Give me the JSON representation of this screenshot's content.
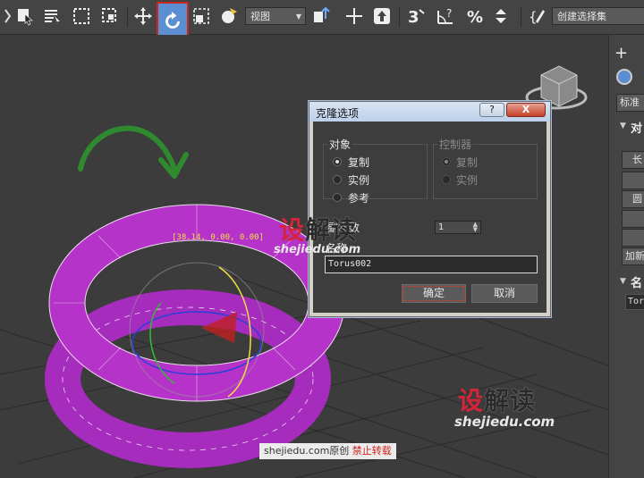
{
  "toolbar": {
    "view_dropdown": "视图",
    "selection_set_placeholder": "创建选择集"
  },
  "right_panel": {
    "tab_label": "标准",
    "section1_label": "对",
    "btn_labels": [
      "长",
      "圆",
      "加新"
    ],
    "section2_label": "名",
    "name_value": "Tor"
  },
  "dialog": {
    "title": "克隆选项",
    "help_label": "?",
    "close_label": "X",
    "object_group": {
      "label": "对象",
      "options": [
        "复制",
        "实例",
        "参考"
      ],
      "selected": "复制"
    },
    "controller_group": {
      "label": "控制器",
      "options": [
        "复制",
        "实例"
      ],
      "selected": "复制"
    },
    "copies_label": "副本数",
    "copies_value": "1",
    "name_label": "名称",
    "name_value": "Torus002",
    "ok_label": "确定",
    "cancel_label": "取消"
  },
  "viewport": {
    "coord_readout": "[38.14, 0.00, 0.00]"
  },
  "watermarks": {
    "logo_left": "设",
    "logo_right": "解读",
    "url": "shejiedu.com",
    "footer_site": "shejiedu.com原创",
    "footer_warning": "禁止转载"
  },
  "colors": {
    "torus": "#b633c9",
    "active_button": "#5b8fd1",
    "highlight_box": "#c8261f",
    "arrow": "#2f8a2f"
  }
}
